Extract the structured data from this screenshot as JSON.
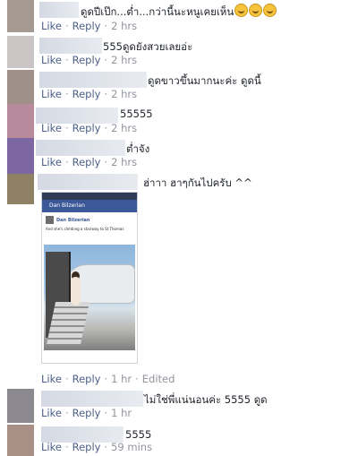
{
  "actions": {
    "like": "Like",
    "reply": "Reply",
    "edited": "Edited"
  },
  "comments": [
    {
      "text": "ดูดปีเป๊ก...ต่ำ...กว่านี้นะหนูเคยเห็น",
      "time": "2 hrs"
    },
    {
      "text": "555ดูดยังสวยเลยอ่ะ",
      "time": "2 hrs"
    },
    {
      "text": "ดูดขาวขึ้นมากนะค่ะ ดูดนี้",
      "time": "2 hrs"
    },
    {
      "text": "55555",
      "time": "2 hrs"
    },
    {
      "text": "ต่ำจัง",
      "time": "2 hrs"
    },
    {
      "text": "ฮ่าาา ฮาๆกันไปครับ ^^",
      "time": "1 hr"
    },
    {
      "text": "ไม่ใช่พี่แน่นอนค่ะ 5555 ดูด",
      "time": "1 hr"
    },
    {
      "text": "5555",
      "time": "59 mins"
    }
  ],
  "photo": {
    "header": "Dan Bilzerian",
    "author": "Dan Bilzerian",
    "caption": "And she's climbing a stairway to St Thomas"
  },
  "colors": {
    "link": "#4b5f87",
    "meta": "#90949c",
    "fb_blue": "#3b5998"
  },
  "icons": [
    "grinning-emoji-icon"
  ]
}
